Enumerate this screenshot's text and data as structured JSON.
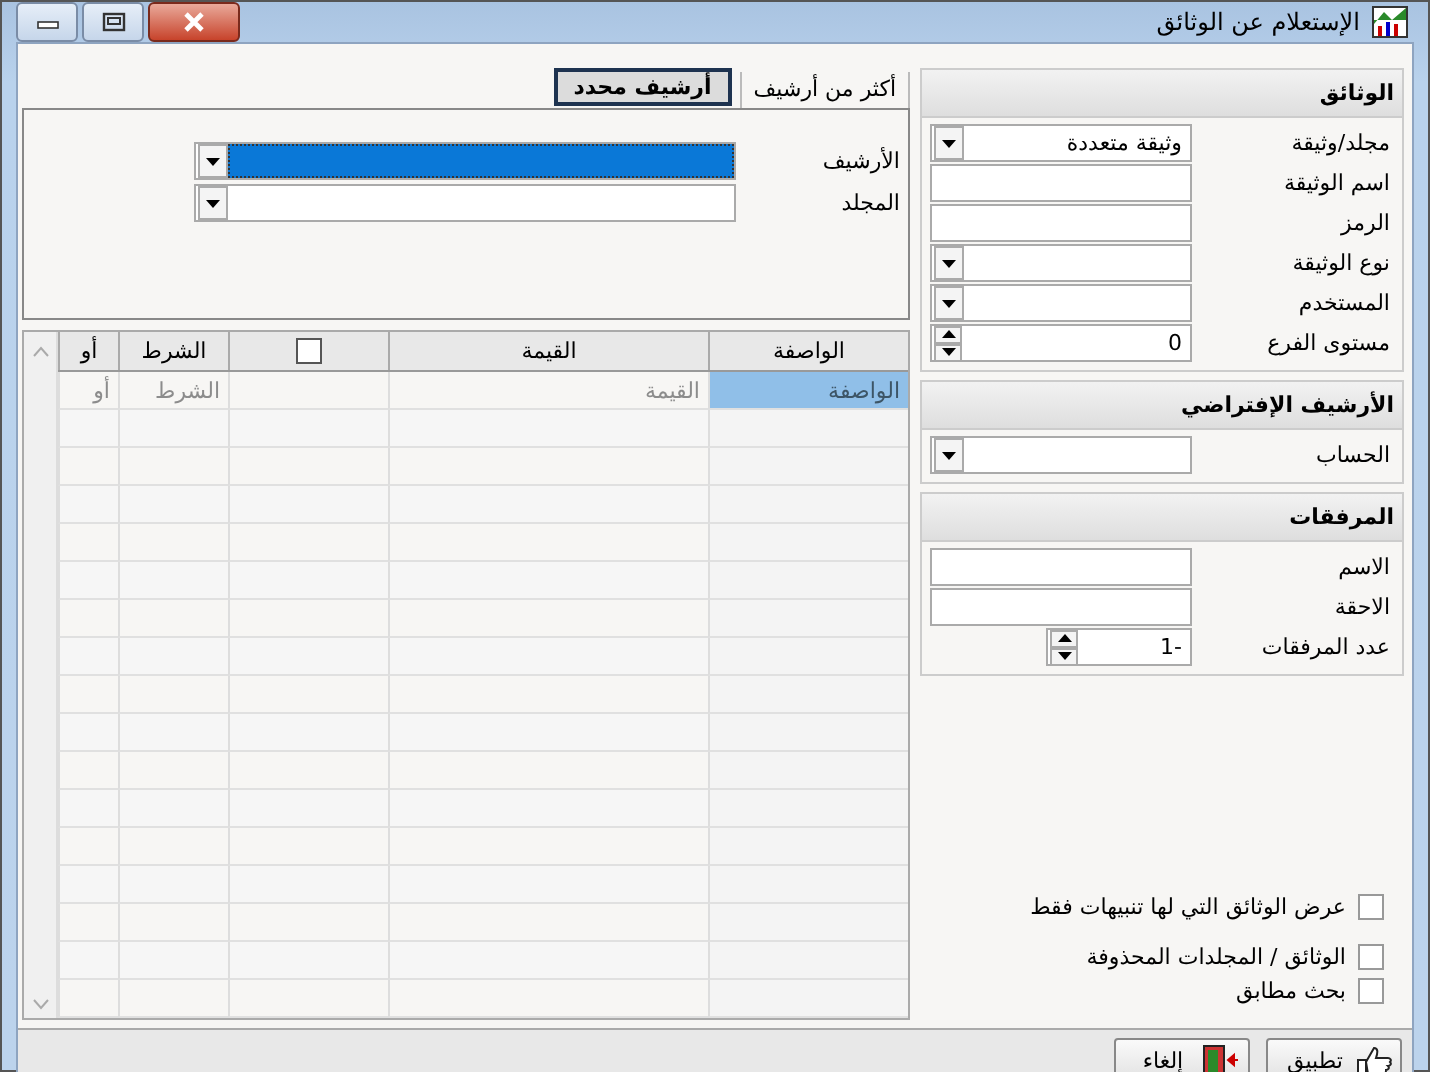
{
  "window": {
    "title": "الإستعلام عن الوثائق",
    "controls": [
      {
        "kind": "minimize"
      },
      {
        "kind": "restore"
      },
      {
        "kind": "close"
      }
    ]
  },
  "tabs": [
    {
      "label": "أكثر من أرشيف",
      "selected": false
    },
    {
      "label": "أرشيف محدد",
      "selected": true
    }
  ],
  "tab_panel": {
    "fields": [
      {
        "label": "الأرشيف",
        "highlighted": true
      },
      {
        "label": "المجلد",
        "highlighted": false
      }
    ]
  },
  "grid": {
    "columns": [
      {
        "kind": "text",
        "label": "الواصفة"
      },
      {
        "kind": "text",
        "label": "القيمة"
      },
      {
        "kind": "checkbox",
        "checked": false
      },
      {
        "kind": "text",
        "label": "الشرط"
      },
      {
        "kind": "text",
        "label": "أو"
      }
    ],
    "new_row": [
      {
        "placeholder": "الواصفة",
        "selected": true
      },
      {
        "placeholder": "القيمة",
        "selected": false
      },
      {
        "selected": false
      },
      {
        "placeholder": "الشرط",
        "selected": false
      },
      {
        "placeholder": "أو",
        "selected": false
      }
    ]
  },
  "groups": [
    {
      "title": "الوثائق",
      "fields": [
        {
          "label": "مجلد/وثيقة",
          "kind": "dropdown",
          "value": "وثيقة متعددة"
        },
        {
          "label": "اسم الوثيقة",
          "kind": "text"
        },
        {
          "label": "الرمز",
          "kind": "text"
        },
        {
          "label": "نوع الوثيقة",
          "kind": "dropdown"
        },
        {
          "label": "المستخدم",
          "kind": "dropdown"
        },
        {
          "label": "مستوى الفرع",
          "kind": "spin",
          "value": "0"
        }
      ]
    },
    {
      "title": "الأرشيف الإفتراضي",
      "fields": [
        {
          "label": "الحساب",
          "kind": "dropdown"
        }
      ]
    },
    {
      "title": "المرفقات",
      "fields": [
        {
          "label": "الاسم",
          "kind": "text"
        },
        {
          "label": "الاحقة",
          "kind": "text"
        },
        {
          "label": "عدد المرفقات",
          "kind": "spin_small",
          "value": "-1"
        }
      ]
    }
  ],
  "options": [
    {
      "label": "عرض الوثائق التي لها تنبيهات فقط",
      "checked": false
    },
    {
      "label": "الوثائق / المجلدات المحذوفة",
      "checked": false
    },
    {
      "label": "بحث مطابق",
      "checked": false
    }
  ],
  "buttons": [
    {
      "kind": "apply",
      "label": "تطبيق"
    },
    {
      "kind": "cancel",
      "label": "إلغاء"
    }
  ]
}
